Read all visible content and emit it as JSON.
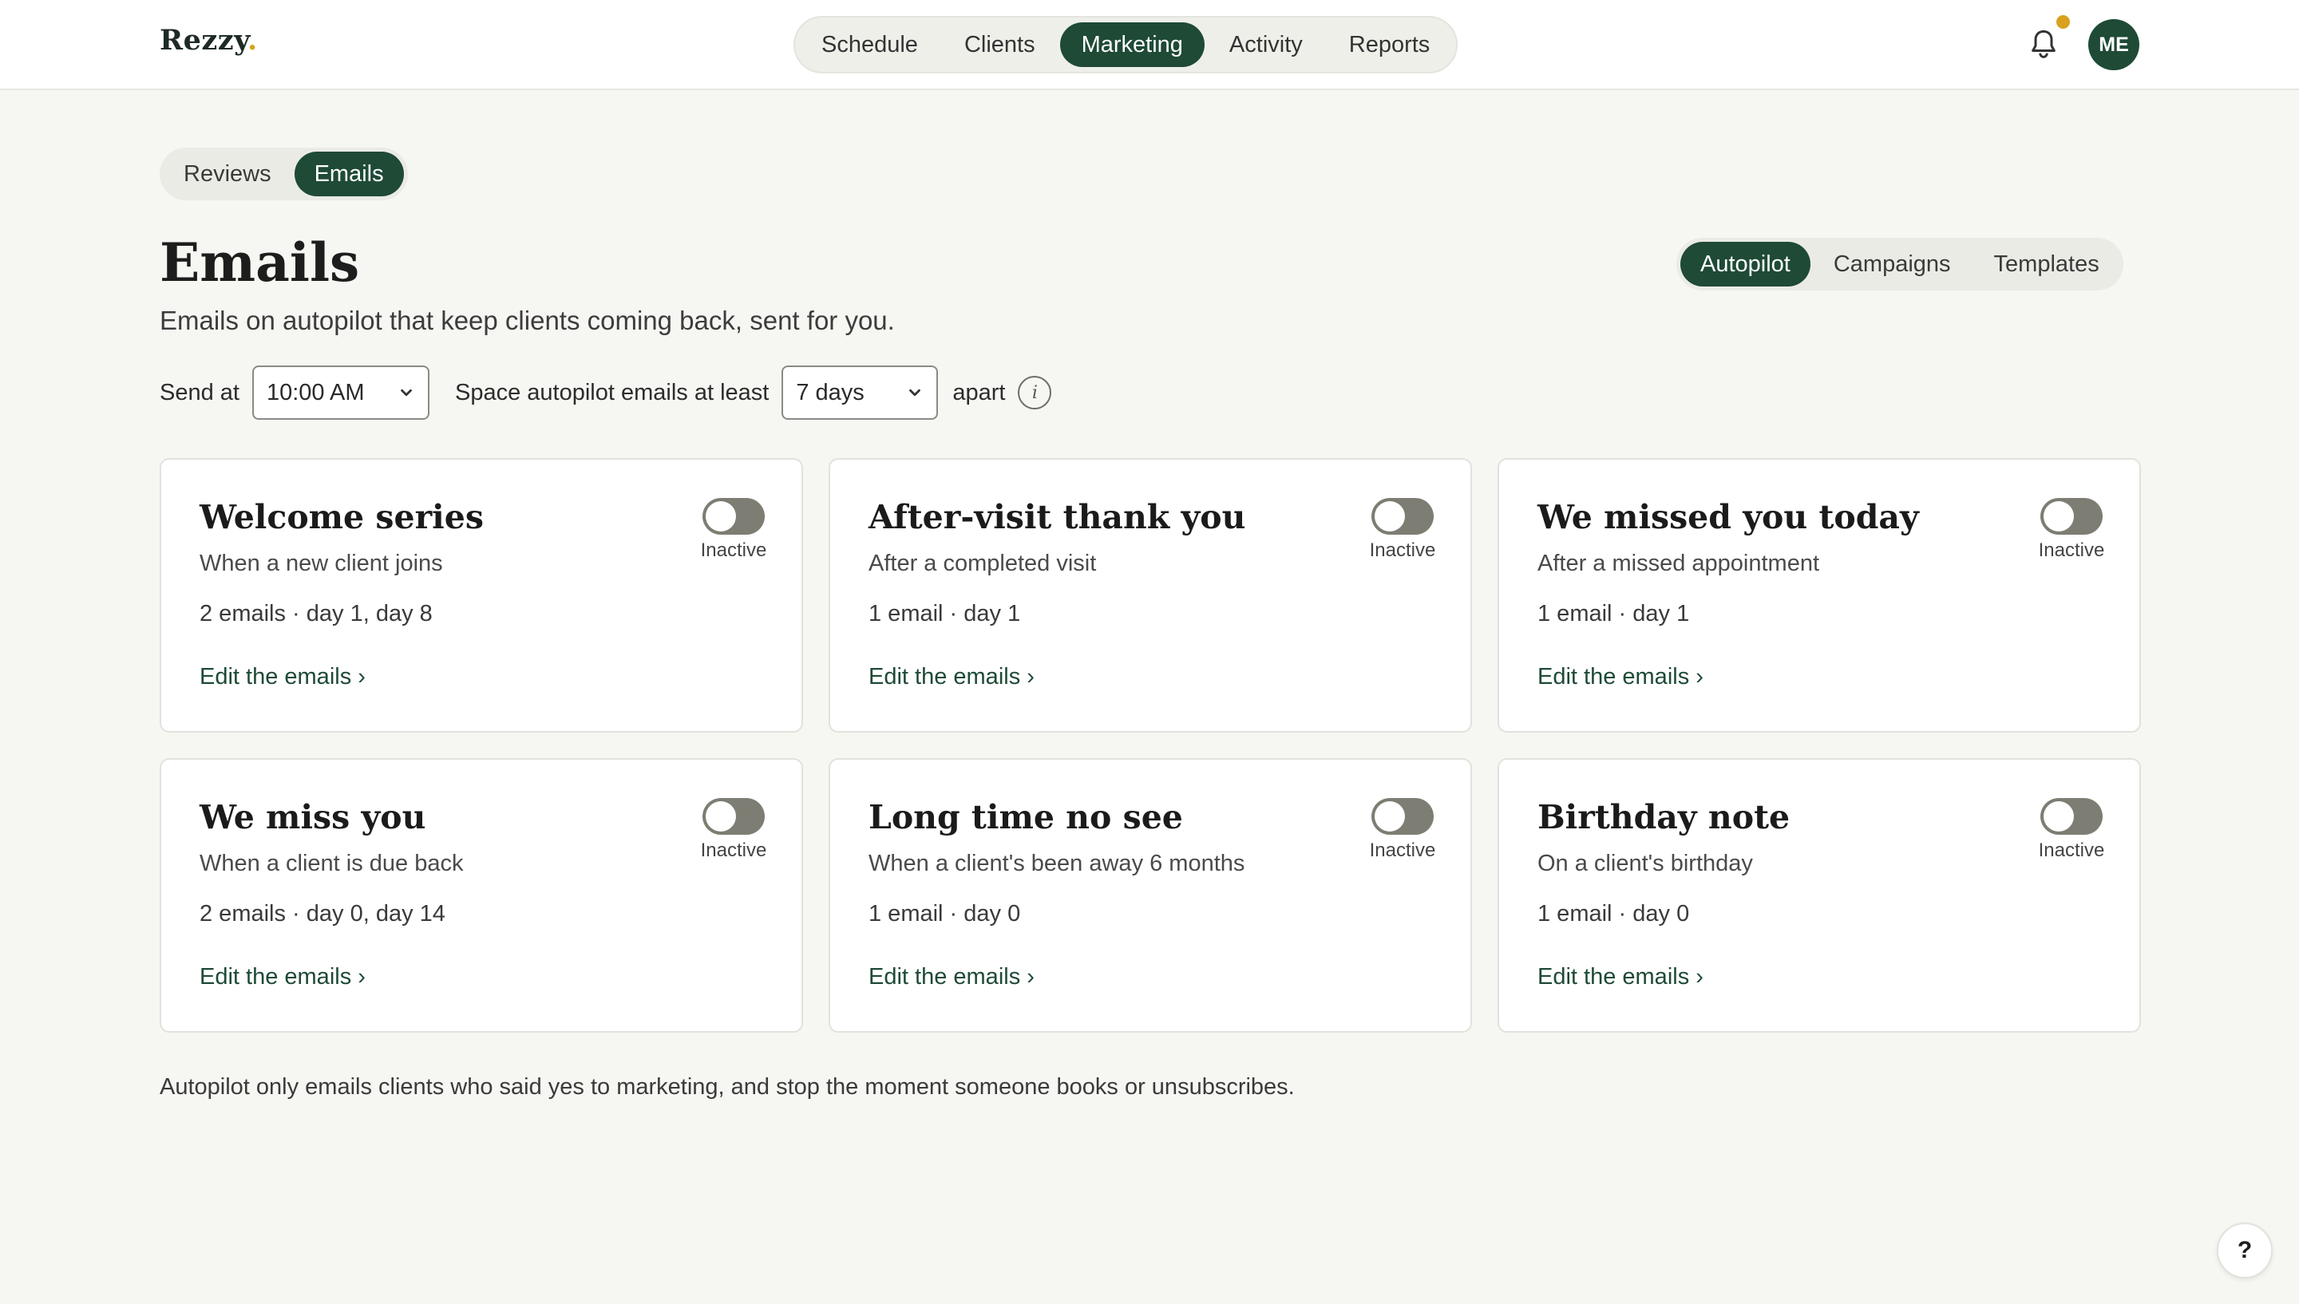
{
  "app": {
    "logo_text": "Rezzy",
    "logo_dot": "."
  },
  "nav": {
    "items": [
      {
        "label": "Schedule"
      },
      {
        "label": "Clients"
      },
      {
        "label": "Marketing"
      },
      {
        "label": "Activity"
      },
      {
        "label": "Reports"
      }
    ],
    "active": "Marketing"
  },
  "header": {
    "avatar_initials": "ME",
    "notification_dot": true,
    "icons": [
      "bell-icon"
    ]
  },
  "section_tabs": {
    "reviews": "Reviews",
    "emails": "Emails",
    "active": "Emails"
  },
  "page": {
    "title": "Emails",
    "subtitle": "Emails on autopilot that keep clients coming back, sent for you."
  },
  "view_tabs": {
    "autopilot": "Autopilot",
    "campaigns": "Campaigns",
    "templates": "Templates",
    "active": "Autopilot"
  },
  "controls": {
    "send_at_label": "Send at",
    "send_at_value": "10:00 AM",
    "space_label": "Space autopilot emails at least",
    "space_value": "7 days",
    "apart_label": "apart",
    "info_glyph": "i"
  },
  "cards": [
    {
      "title": "Welcome series",
      "desc": "When a new client joins",
      "meta": "2 emails · day 1, day 8",
      "link": "Edit the emails ›",
      "status": "Inactive"
    },
    {
      "title": "After-visit thank you",
      "desc": "After a completed visit",
      "meta": "1 email · day 1",
      "link": "Edit the emails ›",
      "status": "Inactive"
    },
    {
      "title": "We missed you today",
      "desc": "After a missed appointment",
      "meta": "1 email · day 1",
      "link": "Edit the emails ›",
      "status": "Inactive"
    },
    {
      "title": "We miss you",
      "desc": "When a client is due back",
      "meta": "2 emails · day 0, day 14",
      "link": "Edit the emails ›",
      "status": "Inactive"
    },
    {
      "title": "Long time no see",
      "desc": "When a client's been away 6 months",
      "meta": "1 email · day 0",
      "link": "Edit the emails ›",
      "status": "Inactive"
    },
    {
      "title": "Birthday note",
      "desc": "On a client's birthday",
      "meta": "1 email · day 0",
      "link": "Edit the emails ›",
      "status": "Inactive"
    }
  ],
  "footnote": "Autopilot only emails clients who said yes to marketing, and stop the moment someone books or unsubscribes.",
  "help_label": "?",
  "colors": {
    "brand": "#1e4a36",
    "accent": "#d9a11e",
    "background": "#f6f6f2",
    "toggle_off": "#7d7d73"
  }
}
